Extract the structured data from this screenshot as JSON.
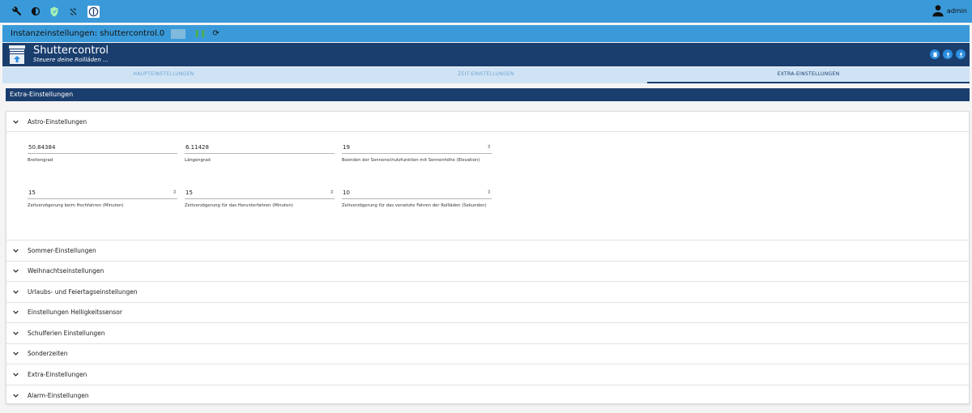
{
  "topbar": {
    "icons": [
      "wrench-icon",
      "contrast-icon",
      "shield-icon",
      "sync-icon",
      "iobroker-logo-icon"
    ],
    "user": "admin"
  },
  "instance": {
    "title": "Instanzeinstellungen: shuttercontrol.0"
  },
  "header": {
    "title": "Shuttercontrol",
    "subtitle": "Steuere deine Rollläden ..."
  },
  "tabs": [
    {
      "label": "HAUPTEINSTELLUNGEN"
    },
    {
      "label": "ZEIT-EINSTELLUNGEN"
    },
    {
      "label": "EXTRA-EINSTELLUNGEN"
    }
  ],
  "section_title": "Extra-Einstellungen",
  "accordion": {
    "open": {
      "title": "Astro-Einstellungen",
      "fields": [
        {
          "value": "50.84384",
          "label": "Breitengrad"
        },
        {
          "value": "6.11428",
          "label": "Längengrad"
        },
        {
          "value": "19",
          "label": "Beenden der Sonnenschutzfunktion mit Sonnenhöhe (Elevation)"
        },
        {
          "value": "15",
          "label": "Zeitverzögerung beim Hochfahren (Minuten)"
        },
        {
          "value": "15",
          "label": "Zeitverzögerung für das Herunterfahren (Minuten)"
        },
        {
          "value": "10",
          "label": "Zeitverzögerung für das versetzte Fahren der Rollläden (Sekunden)"
        }
      ]
    },
    "collapsed": [
      {
        "title": "Sommer-Einstellungen"
      },
      {
        "title": "Weihnachtseinstellungen"
      },
      {
        "title": "Urlaubs- und Feiertagseinstellungen"
      },
      {
        "title": "Einstellungen Helligkeitssensor"
      },
      {
        "title": "Schulferien Einstellungen"
      },
      {
        "title": "Sonderzeiten"
      },
      {
        "title": "Extra-Einstellungen"
      },
      {
        "title": "Alarm-Einstellungen"
      }
    ]
  }
}
